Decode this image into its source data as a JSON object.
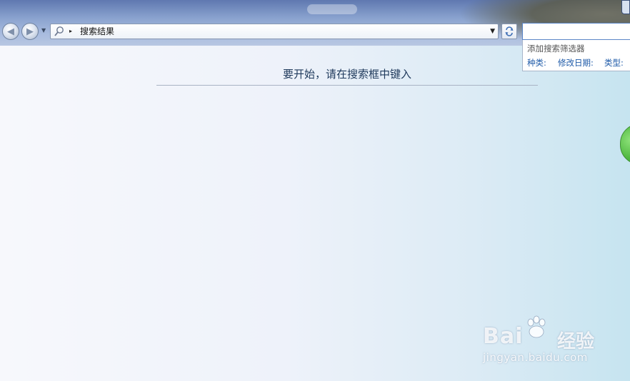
{
  "toolbar": {
    "back_icon": "back-arrow-icon",
    "forward_icon": "forward-arrow-icon",
    "history_icon": "chevron-down-icon",
    "refresh_icon": "refresh-icon"
  },
  "address": {
    "search_icon": "search-icon",
    "breadcrumb_arrow": "▸",
    "location": "搜索结果",
    "dropdown_icon": "chevron-down-icon"
  },
  "search": {
    "value": "",
    "filter_title": "添加搜索筛选器",
    "filters": [
      "种类:",
      "修改日期:",
      "类型:"
    ]
  },
  "main": {
    "prompt": "要开始，请在搜索框中键入"
  },
  "watermark": {
    "brand": "Bai",
    "brand_tail": "经验",
    "url": "jingyan.baidu.com"
  },
  "colors": {
    "accent": "#1e5aa8",
    "prompt_text": "#1e395b",
    "green_tab": "#4fb840"
  }
}
